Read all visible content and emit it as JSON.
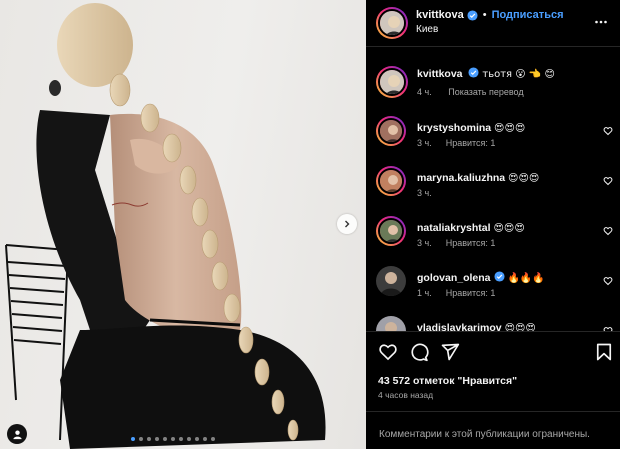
{
  "colors": {
    "accent": "#4a9eff",
    "secondary_text": "#a8a8a8",
    "like_heart": "#f5f5f5"
  },
  "post": {
    "carousel": {
      "dot_count": 11,
      "active_index": 0,
      "next_icon": "chevron-right-icon",
      "tag_icon": "user-tag-icon"
    }
  },
  "header": {
    "username": "kvittkova",
    "verified": true,
    "separator": "•",
    "follow_label": "Подписаться",
    "location": "Киев",
    "more_icon": "more-horizontal-icon"
  },
  "caption": {
    "username": "kvittkova",
    "text": "тьотя 😮 👈 😊",
    "time": "4 ч.",
    "translate": "Показать перевод"
  },
  "comments": [
    {
      "username": "krystyshomina",
      "text": "😍😍😍",
      "time": "3 ч.",
      "likes": "Нравится: 1"
    },
    {
      "username": "maryna.kaliuzhna",
      "text": "😍😍😍",
      "time": "3 ч.",
      "likes": ""
    },
    {
      "username": "nataliakryshtal",
      "text": "😍😍😍",
      "time": "3 ч.",
      "likes": "Нравится: 1"
    },
    {
      "username": "golovan_olena",
      "verified": true,
      "text": "🔥🔥🔥",
      "time": "1 ч.",
      "likes": "Нравится: 1"
    },
    {
      "username": "vladislavkarimov",
      "text": "😍😍😍",
      "time": "",
      "likes": ""
    }
  ],
  "actions": {
    "like_icon": "heart-icon",
    "comment_icon": "comment-icon",
    "share_icon": "share-icon",
    "save_icon": "bookmark-icon"
  },
  "likes_text": "43 572 отметок \"Нравится\"",
  "posted_time": "4 часов назад",
  "comments_restricted": "Комментарии к этой публикации ограничены."
}
